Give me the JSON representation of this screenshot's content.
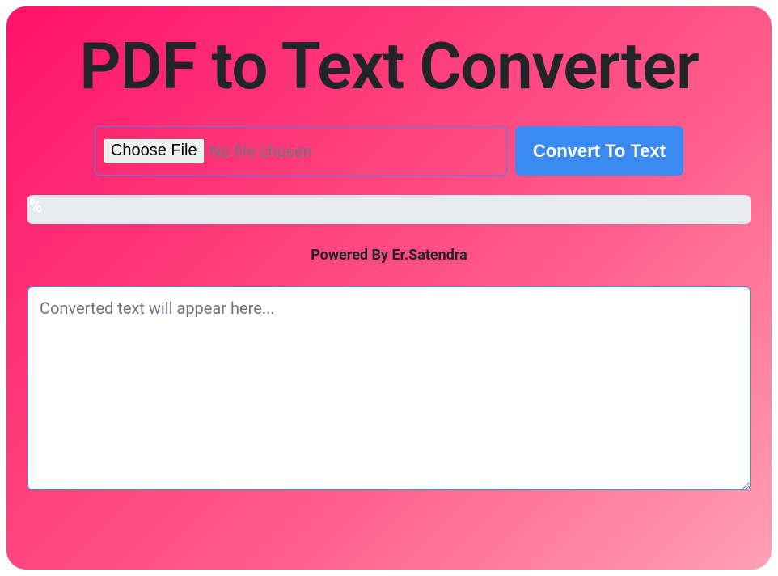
{
  "title": "PDF to Text Converter",
  "file_input": {
    "choose_label": "Choose File",
    "status": "No file chosen"
  },
  "convert_button_label": "Convert To Text",
  "progress_text": "%",
  "powered_by": "Powered By Er.Satendra",
  "output": {
    "placeholder": "Converted text will appear here...",
    "value": ""
  }
}
